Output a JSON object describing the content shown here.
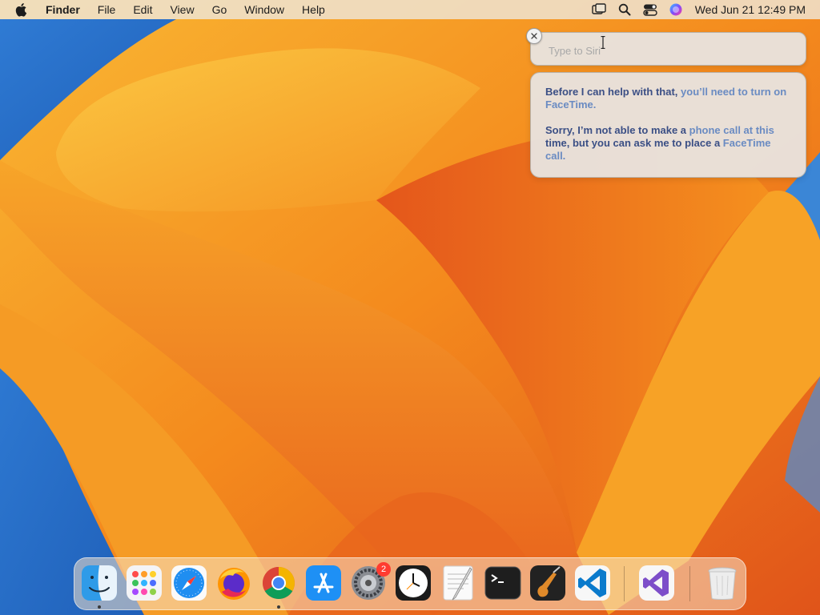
{
  "menubar": {
    "app_name": "Finder",
    "items": [
      "File",
      "Edit",
      "View",
      "Go",
      "Window",
      "Help"
    ],
    "clock": "Wed Jun 21  12:49 PM"
  },
  "siri": {
    "placeholder": "Type to Siri",
    "response_1_dark": "Before I can help with that,",
    "response_1_light": " you’ll need to turn on",
    "response_1_tail": "FaceTime.",
    "response_2_dark_a": "Sorry, I’m not able to make a",
    "response_2_light_a": " phone call at this",
    "response_2_dark_b": "time, but you can ask me to place a",
    "response_2_light_b": " FaceTime",
    "response_2_dark_c": "call."
  },
  "dock": {
    "apps": [
      {
        "name": "Finder",
        "icon": "finder-icon",
        "running": true
      },
      {
        "name": "Launchpad",
        "icon": "launchpad-icon",
        "running": false
      },
      {
        "name": "Safari",
        "icon": "safari-icon",
        "running": false
      },
      {
        "name": "Firefox",
        "icon": "firefox-icon",
        "running": false
      },
      {
        "name": "Google Chrome",
        "icon": "chrome-icon",
        "running": true
      },
      {
        "name": "App Store",
        "icon": "app-store-icon",
        "running": false
      },
      {
        "name": "System Settings",
        "icon": "system-settings-icon",
        "running": false
      },
      {
        "name": "Clock",
        "icon": "clock-icon",
        "running": false
      },
      {
        "name": "TextEdit",
        "icon": "textedit-icon",
        "running": false
      },
      {
        "name": "Terminal",
        "icon": "terminal-icon",
        "running": false
      },
      {
        "name": "GarageBand",
        "icon": "garageband-icon",
        "running": false
      },
      {
        "name": "Visual Studio Code",
        "icon": "vscode-icon",
        "running": false
      },
      {
        "name": "Visual Studio",
        "icon": "visual-studio-icon",
        "running": false
      },
      {
        "name": "Trash",
        "icon": "trash-icon",
        "running": false
      }
    ],
    "settings_badge": "2"
  },
  "colors": {
    "siri_text_dark": "#3b4f85",
    "siri_text_light": "#6a8bc2",
    "badge": "#ff3b30"
  }
}
